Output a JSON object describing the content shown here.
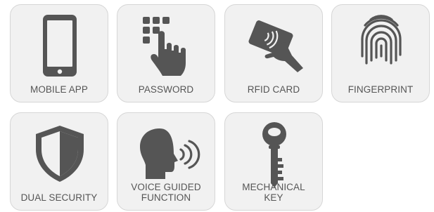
{
  "features": [
    {
      "label": "MOBILE APP",
      "icon": "smartphone-icon"
    },
    {
      "label": "PASSWORD",
      "icon": "keypad-touch-icon"
    },
    {
      "label": "RFID CARD",
      "icon": "rfid-card-hand-icon"
    },
    {
      "label": "FINGERPRINT",
      "icon": "fingerprint-icon"
    },
    {
      "label": "DUAL SECURITY",
      "icon": "shield-icon"
    },
    {
      "label": "VOICE GUIDED\nFUNCTION",
      "icon": "voice-head-icon"
    },
    {
      "label": "MECHANICAL\nKEY",
      "icon": "key-icon"
    }
  ],
  "colors": {
    "tile_background": "#f1f1f1",
    "tile_border": "#d6d6d6",
    "icon": "#555555",
    "label": "#555555"
  }
}
